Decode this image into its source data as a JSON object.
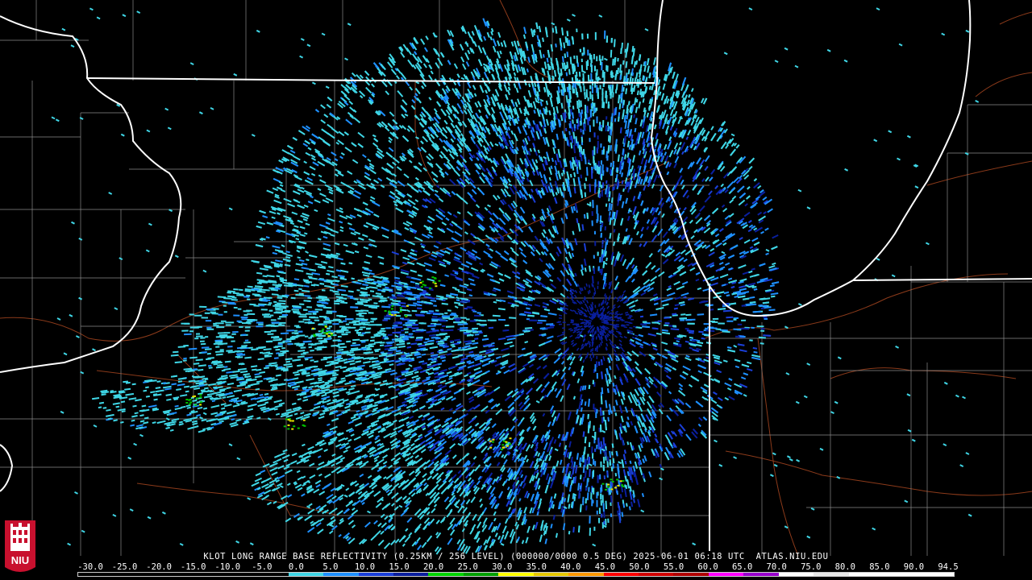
{
  "product": {
    "title": "KLOT LONG RANGE BASE REFLECTIVITY (0.25KM / 256 LEVEL) (000000/0000 0.5 DEG) 2025-06-01 06:18 UTC  ATLAS.NIU.EDU",
    "radar_site": "KLOT",
    "elevation_deg": 0.5,
    "timestamp": "2025-06-01 06:18 UTC",
    "source": "ATLAS.NIU.EDU"
  },
  "legend": {
    "labels": [
      "-30.0",
      "-25.0",
      "-20.0",
      "-15.0",
      "-10.0",
      "-5.0",
      "0.0",
      "5.0",
      "10.0",
      "15.0",
      "20.0",
      "25.0",
      "30.0",
      "35.0",
      "40.0",
      "45.0",
      "50.0",
      "55.0",
      "60.0",
      "65.0",
      "70.0",
      "75.0",
      "80.0",
      "85.0",
      "90.0",
      "94.5"
    ],
    "colors": [
      "#000000",
      "#000000",
      "#000000",
      "#000000",
      "#000000",
      "#000000",
      "#3fd6e6",
      "#1e90ff",
      "#1a3fd9",
      "#0a1f9e",
      "#00d400",
      "#00a000",
      "#ffff00",
      "#e6c800",
      "#ff9900",
      "#ff0000",
      "#d10000",
      "#b00000",
      "#ff00ff",
      "#9900cc",
      "#ffffff",
      "#e8e8e8",
      "#ffffff",
      "#ffffff",
      "#ffffff"
    ]
  },
  "map": {
    "background_color": "#000000",
    "state_border_color": "#ffffff",
    "county_border_color": "#8a8a8a",
    "highway_color": "#8b3a1a",
    "echo_colors": {
      "light": "#3fd6e6",
      "mid": "#1e90ff",
      "dark": "#1a3fd9",
      "deep": "#0a1f9e",
      "green": "#00c000",
      "yellow": "#e6e600"
    }
  },
  "logo": {
    "text": "NIU",
    "color": "#c8102e"
  }
}
